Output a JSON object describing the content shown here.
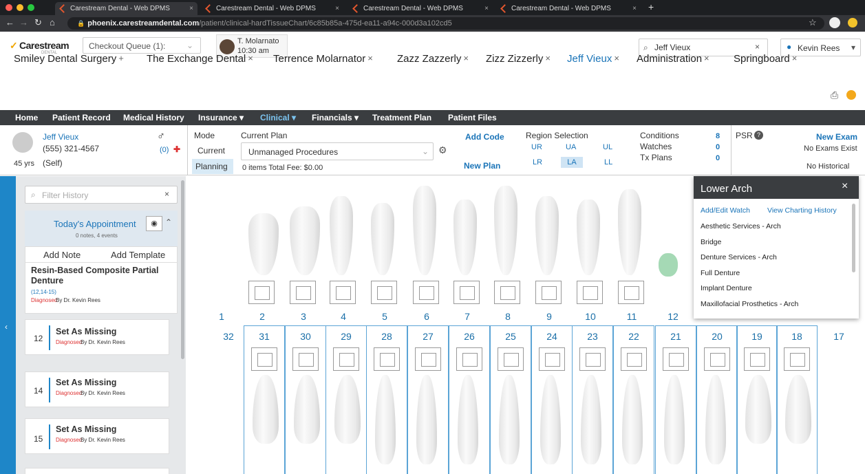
{
  "browser": {
    "tabs": [
      {
        "label": "Carestream Dental - Web DPMS"
      },
      {
        "label": "Carestream Dental - Web DPMS"
      },
      {
        "label": "Carestream Dental - Web DPMS"
      },
      {
        "label": "Carestream Dental - Web DPMS"
      }
    ],
    "new_tab": "+",
    "url_host": "phoenix.carestreamdental.com",
    "url_path": "/patient/clinical-hardTissueChart/6c85b85a-475d-ea11-a94c-000d3a102cd5"
  },
  "header": {
    "logo": "Carestream",
    "logo_sub": "DENTAL",
    "queue_label": "Checkout Queue (1):",
    "appt_name": "T. Molarnato",
    "appt_time": "10:30 am",
    "search_value": "Jeff Vieux",
    "user": "Kevin Rees"
  },
  "patient_tabs": [
    {
      "label": "Smiley Dental Surgery",
      "mark": "+"
    },
    {
      "label": "The Exchange Dental",
      "mark": "×"
    },
    {
      "label": "Terrence Molarnator",
      "mark": "×"
    },
    {
      "label": "Zazz Zazzerly",
      "mark": "×"
    },
    {
      "label": "Zizz Zizzerly",
      "mark": "×"
    },
    {
      "label": "Jeff Vieux",
      "mark": "×"
    },
    {
      "label": "Administration",
      "mark": "×"
    },
    {
      "label": "Springboard",
      "mark": "×"
    }
  ],
  "nav": [
    "Home",
    "Patient Record",
    "Medical History",
    "Insurance ▾",
    "Clinical ▾",
    "Financials ▾",
    "Treatment Plan",
    "Patient Files"
  ],
  "patient": {
    "name": "Jeff Vieux",
    "phone": "(555) 321-4567",
    "age": "45 yrs",
    "relation": "(Self)",
    "alerts": "(0)",
    "mode_label": "Mode",
    "mode_current": "Current",
    "mode_planning": "Planning",
    "plan_label": "Current Plan",
    "plan_value": "Unmanaged Procedures",
    "plan_fee": "0 items Total Fee: $0.00",
    "add_code": "Add Code",
    "new_plan": "New Plan",
    "region_label": "Region Selection",
    "regions": [
      "UR",
      "UA",
      "UL",
      "LR",
      "LA",
      "LL"
    ],
    "conditions_label": "Conditions",
    "conditions": "8",
    "watches_label": "Watches",
    "watches": "0",
    "txplans_label": "Tx Plans",
    "txplans": "0",
    "psr": "PSR",
    "new_exam": "New Exam",
    "no_exams": "No Exams Exist",
    "no_historical": "No Historical"
  },
  "sidebar": {
    "filter_placeholder": "Filter History",
    "appt_title": "Today's Appointment",
    "appt_meta": "0 notes, 4 events",
    "add_note": "Add Note",
    "add_template": "Add Template",
    "first_entry": {
      "title": "Resin-Based Composite Partial Denture",
      "teeth": "(12,14-15)",
      "status": "Diagnosed",
      "by": "By Dr. Kevin Rees"
    },
    "entries": [
      {
        "tooth": "12",
        "title": "Set As Missing",
        "status": "Diagnosed",
        "by": "By Dr. Kevin Rees"
      },
      {
        "tooth": "14",
        "title": "Set As Missing",
        "status": "Diagnosed",
        "by": "By Dr. Kevin Rees"
      },
      {
        "tooth": "15",
        "title": "Set As Missing",
        "status": "Diagnosed",
        "by": "By Dr. Kevin Rees"
      }
    ]
  },
  "chart": {
    "upper_numbers": [
      "1",
      "2",
      "3",
      "4",
      "5",
      "6",
      "7",
      "8",
      "9",
      "10",
      "11",
      "12"
    ],
    "lower_numbers": [
      "32",
      "31",
      "30",
      "29",
      "28",
      "27",
      "26",
      "25",
      "24",
      "23",
      "22",
      "21",
      "20",
      "19",
      "18",
      "17"
    ]
  },
  "popup": {
    "title": "Lower Arch",
    "close": "×",
    "add_edit": "Add/Edit Watch",
    "view_history": "View Charting History",
    "items": [
      "Aesthetic Services - Arch",
      "Bridge",
      "Denture Services - Arch",
      "Full Denture",
      "Implant Denture",
      "Maxillofacial Prosthetics - Arch"
    ]
  }
}
